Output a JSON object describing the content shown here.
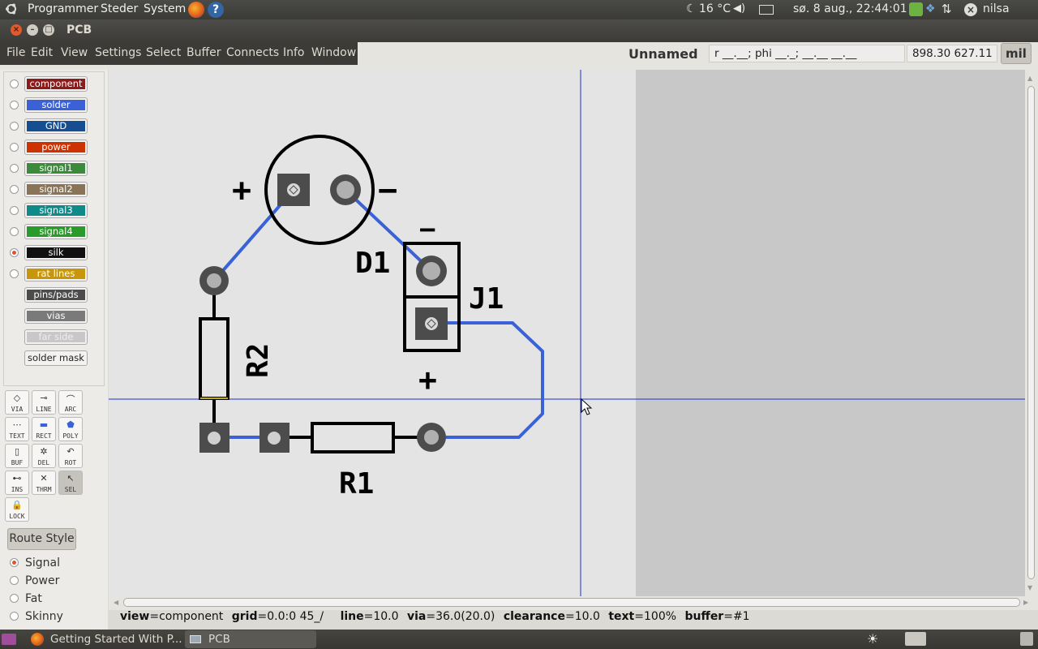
{
  "top_panel": {
    "menus": [
      "Programmer",
      "Steder",
      "System"
    ],
    "weather": "16 °C",
    "datetime": "sø.  8 aug., 22:44:01",
    "user": "nilsa"
  },
  "window": {
    "title": "PCB"
  },
  "menubar": [
    "File",
    "Edit",
    "View",
    "Settings",
    "Select",
    "Buffer",
    "Connects",
    "Info",
    "Window"
  ],
  "header": {
    "doc_name": "Unnamed",
    "polar_coords": "r __.__; phi __._; __.__ __.__",
    "cursor_coords": "898.30 627.11",
    "units": "mil"
  },
  "layers": [
    {
      "label": "component",
      "color": "#8b1c1c",
      "selectable": true,
      "selected": false
    },
    {
      "label": "solder",
      "color": "#3a62d6",
      "selectable": true,
      "selected": false
    },
    {
      "label": "GND",
      "color": "#154f91",
      "selectable": true,
      "selected": false
    },
    {
      "label": "power",
      "color": "#cc3300",
      "selectable": true,
      "selected": false
    },
    {
      "label": "signal1",
      "color": "#3c8a3c",
      "selectable": true,
      "selected": false
    },
    {
      "label": "signal2",
      "color": "#8a7458",
      "selectable": true,
      "selected": false
    },
    {
      "label": "signal3",
      "color": "#0f8a8a",
      "selectable": true,
      "selected": false
    },
    {
      "label": "signal4",
      "color": "#2a9a2a",
      "selectable": true,
      "selected": false
    },
    {
      "label": "silk",
      "color": "#111111",
      "selectable": true,
      "selected": true
    },
    {
      "label": "rat lines",
      "color": "#c8960a",
      "selectable": true,
      "selected": false
    },
    {
      "label": "pins/pads",
      "color": "#4c4c4c",
      "selectable": false,
      "selected": false
    },
    {
      "label": "vias",
      "color": "#7a7a7a",
      "selectable": false,
      "selected": false
    },
    {
      "label": "far side",
      "color": "#c8c8c8",
      "selectable": false,
      "selected": false
    },
    {
      "label": "solder mask",
      "color": "#f3f2f0",
      "selectable": false,
      "selected": false
    }
  ],
  "tools": [
    {
      "label": "VIA",
      "icon": "via-icon"
    },
    {
      "label": "LINE",
      "icon": "line-icon"
    },
    {
      "label": "ARC",
      "icon": "arc-icon"
    },
    {
      "label": "TEXT",
      "icon": "text-icon"
    },
    {
      "label": "RECT",
      "icon": "rect-icon"
    },
    {
      "label": "POLY",
      "icon": "poly-icon"
    },
    {
      "label": "BUF",
      "icon": "buffer-icon"
    },
    {
      "label": "DEL",
      "icon": "delete-icon"
    },
    {
      "label": "ROT",
      "icon": "rotate-icon"
    },
    {
      "label": "INS",
      "icon": "insert-icon"
    },
    {
      "label": "THRM",
      "icon": "thermal-icon"
    },
    {
      "label": "SEL",
      "icon": "select-icon",
      "active": true
    },
    {
      "label": "LOCK",
      "icon": "lock-icon"
    }
  ],
  "route_style": {
    "button": "Route Style",
    "options": [
      "Signal",
      "Power",
      "Fat",
      "Skinny"
    ],
    "selected": "Signal"
  },
  "board": {
    "labels": {
      "d1": "D1",
      "j1": "J1",
      "r1": "R1",
      "r2": "R2",
      "plus": "+",
      "minus": "−"
    }
  },
  "status": {
    "view": "component",
    "grid": "0.0:0  45_/",
    "line": "10.0",
    "via": "36.0(20.0)",
    "clearance": "10.0",
    "text": "100%",
    "buffer": "#1"
  },
  "taskbar": [
    "Getting Started With P...",
    "PCB"
  ]
}
